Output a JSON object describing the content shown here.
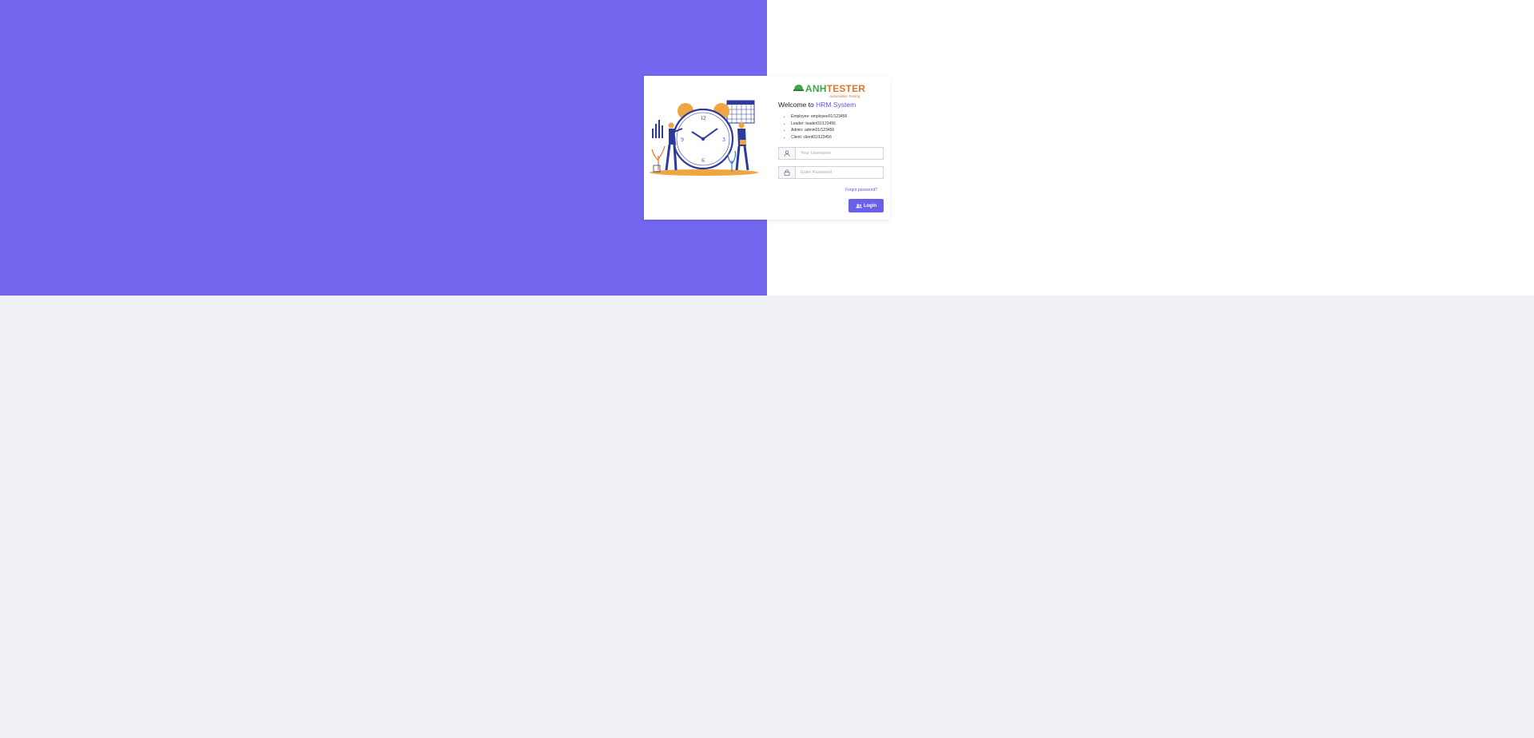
{
  "colors": {
    "accent": "#7366ef",
    "brand_green": "#3fa845",
    "brand_orange": "#e5732a"
  },
  "logo": {
    "part1": "ANH",
    "part2": "TESTER",
    "tagline": "Automation Testing"
  },
  "welcome": {
    "prefix": "Welcome to",
    "brand": "HRM System"
  },
  "credentials": [
    "Employee: employee01/123456",
    "Leader: leader01/123456",
    "Admin: admin01/123456",
    "Client: client01/123456"
  ],
  "username": {
    "placeholder": "Your Username",
    "value": "",
    "icon": "user-icon"
  },
  "password": {
    "placeholder": "Enter Password",
    "value": "",
    "icon": "lock-icon"
  },
  "forgot_label": "Forgot password?",
  "login": {
    "label": "Login",
    "icon": "user-group-icon"
  },
  "illustration": {
    "clock_numbers": [
      "12",
      "3",
      "6",
      "9"
    ]
  }
}
